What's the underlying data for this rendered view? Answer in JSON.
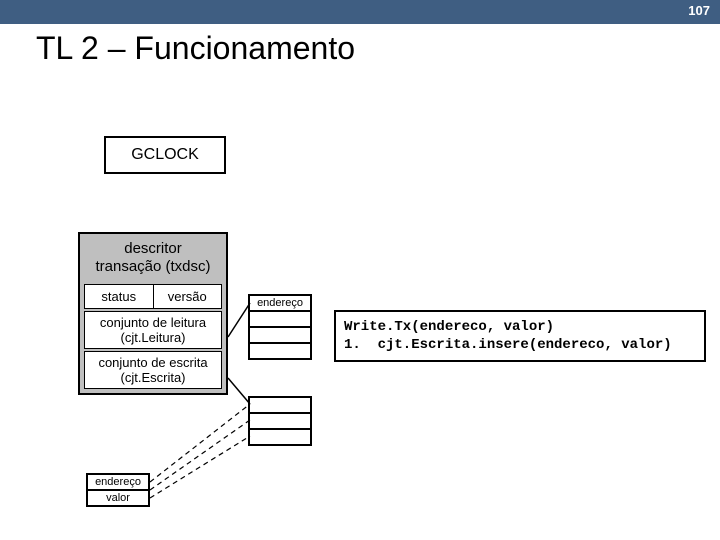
{
  "slide_number": "107",
  "title": "TL 2 – Funcionamento",
  "gclock_label": "GCLOCK",
  "descriptor": {
    "header_line1": "descritor",
    "header_line2": "transação (txdsc)",
    "status": "status",
    "versao": "versão",
    "leitura_line1": "conjunto de leitura",
    "leitura_line2": "(cjt.Leitura)",
    "escrita_line1": "conjunto de escrita",
    "escrita_line2": "(cjt.Escrita)"
  },
  "readset_header": "endereço",
  "code_line1": "Write.Tx(endereco, valor)",
  "code_line2": "1.  cjt.Escrita.insere(endereco, valor)",
  "kv": {
    "endereco": "endereço",
    "valor": "valor"
  }
}
